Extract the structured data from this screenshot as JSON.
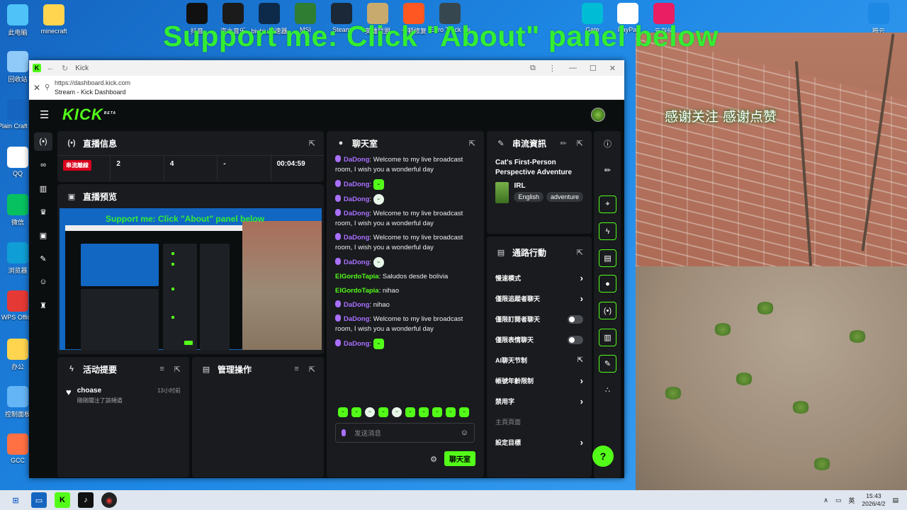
{
  "overlay": {
    "banner": "Support me: Click \"About\" panel below",
    "camera_caption": "感谢关注 感谢点赞"
  },
  "desktop": {
    "left_icons": [
      {
        "label": "此电脑",
        "icon": "computer-icon",
        "color": "#4fc3f7"
      },
      {
        "label": "回收站",
        "icon": "recycle-bin-icon",
        "color": "#90caf9"
      },
      {
        "label": "Plain Craft Launche...",
        "icon": "pcl-icon",
        "color": "#1565c0"
      },
      {
        "label": "QQ",
        "icon": "qq-icon",
        "color": "#ffffff"
      },
      {
        "label": "微信",
        "icon": "wechat-icon",
        "color": "#07c160"
      },
      {
        "label": "浏览器",
        "icon": "edge-icon",
        "color": "#0f9ed5"
      },
      {
        "label": "WPS Office",
        "icon": "wps-icon",
        "color": "#e53935"
      },
      {
        "label": "办公",
        "icon": "folder-icon",
        "color": "#ffd54f"
      },
      {
        "label": "控制面板",
        "icon": "control-panel-icon",
        "color": "#64b5f6"
      },
      {
        "label": "GCC",
        "icon": "gcc-icon",
        "color": "#ff7043"
      }
    ],
    "minecraft_folder": "minecraft",
    "top_icons": [
      {
        "label": "抖音",
        "icon": "tiktok-icon",
        "color": "#111111"
      },
      {
        "label": "汽水音乐",
        "icon": "music-icon",
        "color": "#1b1b1b"
      },
      {
        "label": "biubiu加速器",
        "icon": "biubiu-icon",
        "color": "#0d2a4a"
      },
      {
        "label": "MSI",
        "icon": "msi-icon",
        "color": "#2e7d32"
      },
      {
        "label": "Steam",
        "icon": "steam-icon",
        "color": "#1b2838"
      },
      {
        "label": "英雄联盟",
        "icon": "lol-icon",
        "color": "#c8aa6e"
      },
      {
        "label": "卡顿修复",
        "icon": "network-icon",
        "color": "#ff5722"
      },
      {
        "label": "Euro Truck Simulat...",
        "icon": "truck-icon",
        "color": "#37474f"
      }
    ],
    "top_right_icons": [
      {
        "label": "Gate",
        "icon": "gate-icon",
        "color": "#00bcd4"
      },
      {
        "label": "PayPal",
        "icon": "paypal-icon",
        "color": "#ffffff"
      },
      {
        "label": "云存储",
        "icon": "cloud-ring-icon",
        "color": "#e91e63"
      },
      {
        "label": "腾云",
        "icon": "cloud-icon",
        "color": "#1e88e5"
      }
    ]
  },
  "browser": {
    "tab_title": "Kick",
    "url": "https://dashboard.kick.com",
    "page_title": "Stream - Kick Dashboard"
  },
  "kick": {
    "logo": "KICK",
    "logo_badge": "BETA",
    "brand_color": "#53fc18"
  },
  "stream_info_panel": {
    "title": "直播信息",
    "live_tag": "串流離線",
    "stats": [
      "2",
      "4",
      "-",
      "00:04:59"
    ]
  },
  "preview_panel": {
    "title": "直播预览"
  },
  "activity_panel": {
    "title": "活动提要",
    "items": [
      {
        "name": "choase",
        "text": "剛剛關注了該頻道",
        "time": "13小时前"
      }
    ]
  },
  "mod_panel": {
    "title": "管理操作"
  },
  "chat_panel": {
    "title": "聊天室",
    "messages": [
      {
        "user": "DaDong",
        "color": "#a970ff",
        "text": "Welcome to my live broadcast room, I wish you a wonderful day",
        "emote": false
      },
      {
        "user": "DaDong",
        "color": "#a970ff",
        "text": "",
        "emote": true
      },
      {
        "user": "DaDong",
        "color": "#a970ff",
        "text": "",
        "emote": true
      },
      {
        "user": "DaDong",
        "color": "#a970ff",
        "text": "Welcome to my live broadcast room, I wish you a wonderful day",
        "emote": false
      },
      {
        "user": "DaDong",
        "color": "#a970ff",
        "text": "Welcome to my live broadcast room, I wish you a wonderful day",
        "emote": false
      },
      {
        "user": "DaDong",
        "color": "#a970ff",
        "text": "",
        "emote": true
      },
      {
        "user": "ElGordoTapia",
        "color": "#53fc18",
        "text": "Saludos desde bolivia",
        "emote": false
      },
      {
        "user": "ElGordoTapia",
        "color": "#53fc18",
        "text": "nihao",
        "emote": false
      },
      {
        "user": "DaDong",
        "color": "#a970ff",
        "text": "nihao",
        "emote": false
      },
      {
        "user": "DaDong",
        "color": "#a970ff",
        "text": "Welcome to my live broadcast room, I wish you a wonderful day",
        "emote": false
      },
      {
        "user": "DaDong",
        "color": "#a970ff",
        "text": "",
        "emote": true
      }
    ],
    "input_placeholder": "发送消息",
    "send_label": "聊天室"
  },
  "stream_details_panel": {
    "title": "串流資訊",
    "stream_title": "Cat's First-Person Perspective Adventure",
    "category": "IRL",
    "tags": [
      "English",
      "adventure"
    ]
  },
  "shortcuts_panel": {
    "title": "通路行動",
    "rows": [
      {
        "label": "慢速模式",
        "control": "chevron"
      },
      {
        "label": "僅限追蹤者聊天",
        "control": "chevron"
      },
      {
        "label": "僅限訂閱者聊天",
        "control": "toggle"
      },
      {
        "label": "僅限表情聊天",
        "control": "toggle"
      },
      {
        "label": "AI聊天节制",
        "control": "external"
      },
      {
        "label": "帳號年齡限制",
        "control": "chevron"
      },
      {
        "label": "禁用字",
        "control": "chevron"
      },
      {
        "label": "主頁頁面",
        "control": "none"
      },
      {
        "label": "設定目標",
        "control": "chevron"
      }
    ]
  },
  "taskbar": {
    "ime": "英",
    "time": "15:43",
    "date": "2026/4/2"
  }
}
